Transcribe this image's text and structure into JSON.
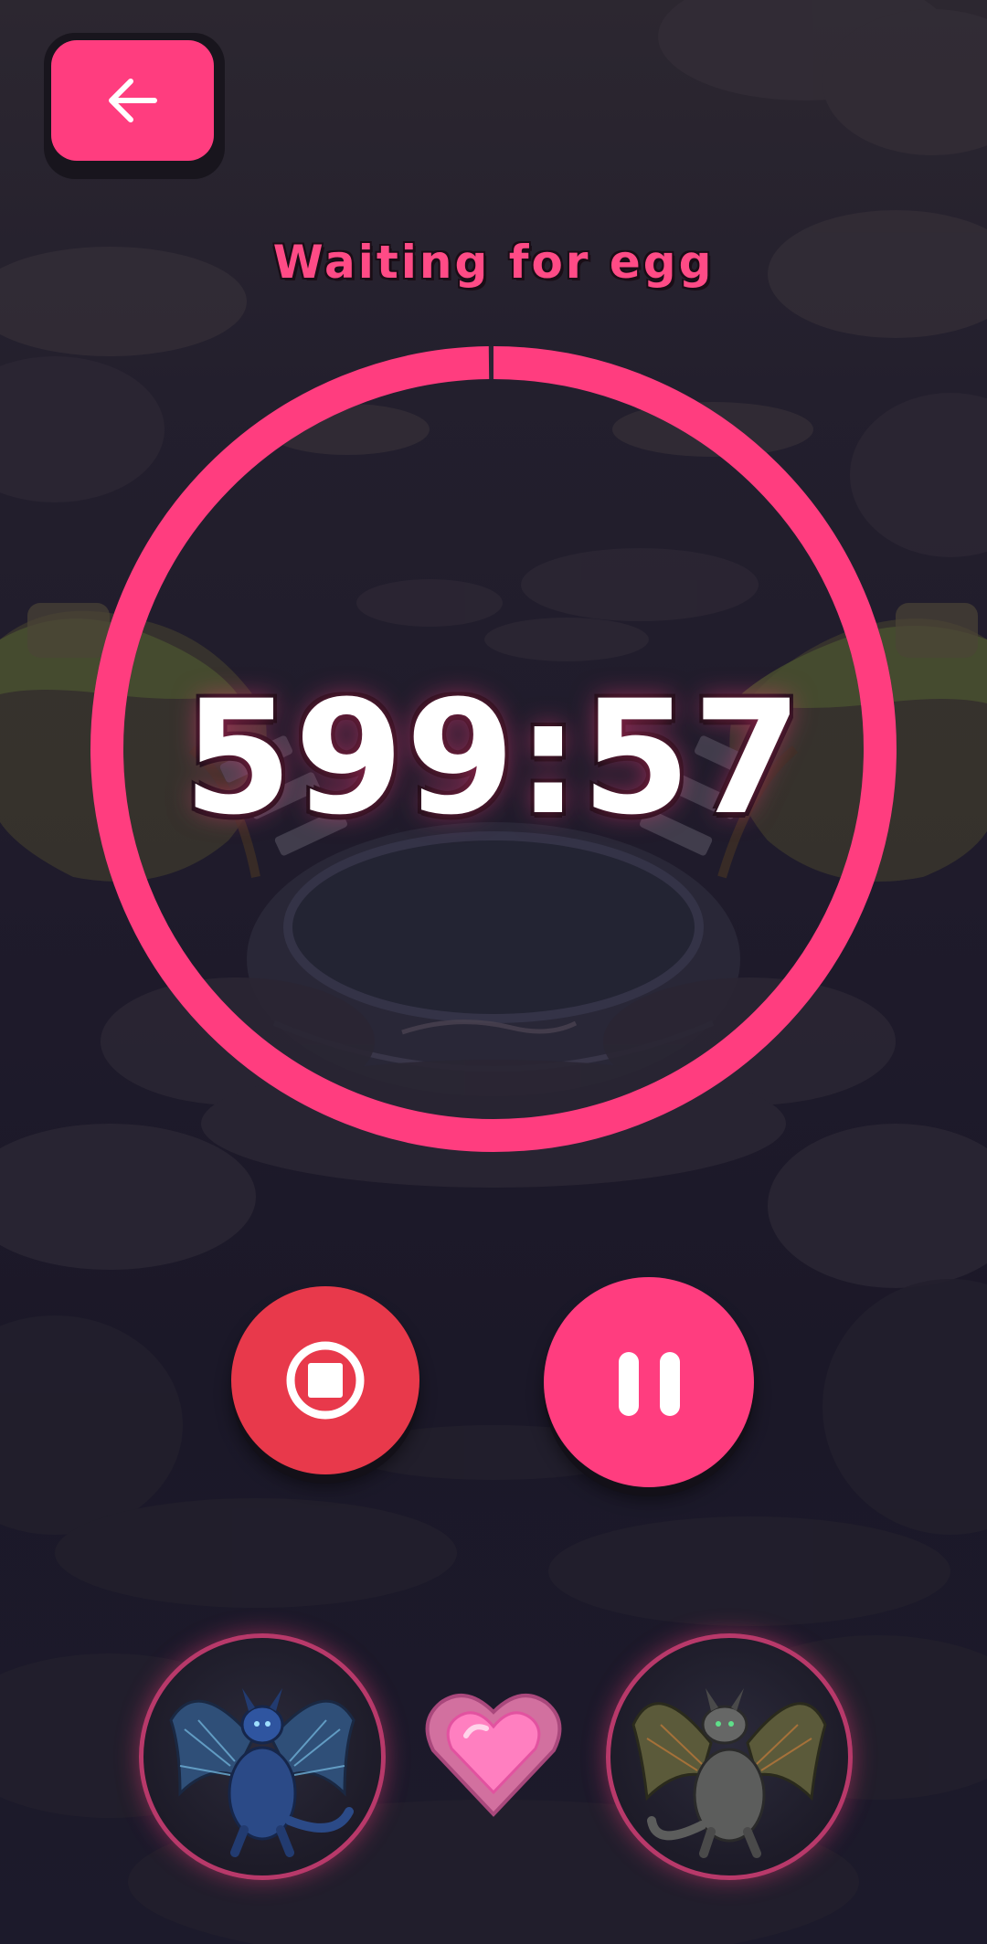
{
  "header": {
    "back_icon": "arrow-left-icon"
  },
  "status": {
    "title": "Waiting for egg"
  },
  "timer": {
    "display": "599:57",
    "progress": 0.998
  },
  "controls": {
    "stop_icon": "stop-icon",
    "pause_icon": "pause-icon"
  },
  "pair": {
    "left_icon": "blue-dragon-avatar",
    "center_icon": "heart-gem-icon",
    "right_icon": "gray-dragon-avatar"
  },
  "colors": {
    "accent": "#ff3d7f",
    "stop": "#e8394b",
    "background": "#231f2d"
  }
}
